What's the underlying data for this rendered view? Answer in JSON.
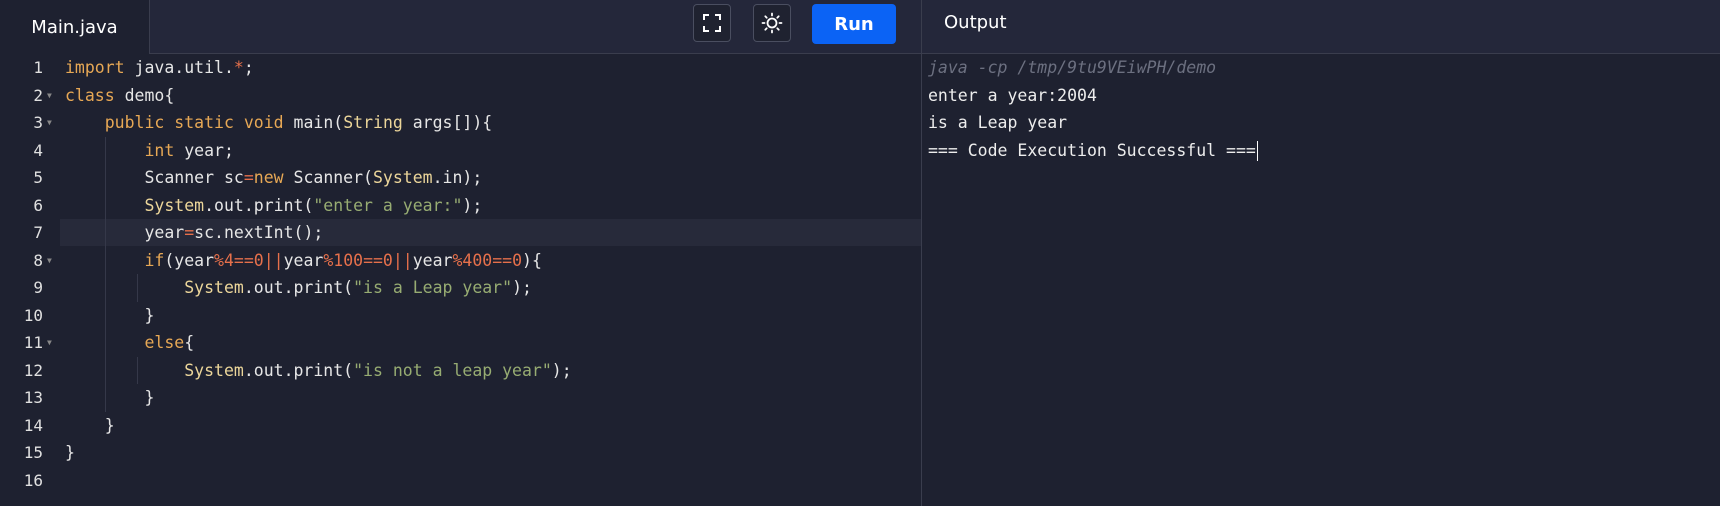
{
  "editor": {
    "filename": "Main.java",
    "line_numbers": [
      "1",
      "2",
      "3",
      "4",
      "5",
      "6",
      "7",
      "8",
      "9",
      "10",
      "11",
      "12",
      "13",
      "14",
      "15",
      "16"
    ]
  },
  "toolbar": {
    "fullscreen_icon": "fullscreen-icon",
    "theme_icon": "sun-icon",
    "run_label": "Run",
    "run_color": "#0b63f5"
  },
  "output": {
    "title": "Output",
    "command": "java -cp /tmp/9tu9VEiwPH/demo",
    "lines": [
      "enter a year:2004",
      "is a Leap year",
      "=== Code Execution Successful ==="
    ]
  },
  "code": {
    "l1": {
      "kw": "import",
      "rest": " java.util.",
      "op": "*",
      "end": ";"
    },
    "l2": {
      "kw": "class",
      "rest": " demo{"
    },
    "l3": {
      "kw1": "public",
      "kw2": "static",
      "kw3": "void",
      "name": " main(",
      "cls": "String",
      "rest": " args[]){"
    },
    "l4": {
      "kw": "int",
      "rest": " year;"
    },
    "l5": {
      "a": "Scanner sc",
      "op1": "=",
      "kw": "new",
      "b": " Scanner(",
      "cls": "System",
      "c": ".in);"
    },
    "l6": {
      "cls": "System",
      "a": ".out.print(",
      "str": "\"enter a year:\"",
      "b": ");"
    },
    "l7": {
      "a": "year",
      "op": "=",
      "b": "sc.nextInt();"
    },
    "l8": {
      "kw": "if",
      "a": "(year",
      "o1": "%4==0||",
      "b": "year",
      "o2": "%100==0||",
      "c": "year",
      "o3": "%400==0",
      "d": "){"
    },
    "l9": {
      "cls": "System",
      "a": ".out.print(",
      "str": "\"is a Leap year\"",
      "b": ");"
    },
    "l10": {
      "a": "}"
    },
    "l11": {
      "kw": "else",
      "a": "{"
    },
    "l12": {
      "cls": "System",
      "a": ".out.print(",
      "str": "\"is not a leap year\"",
      "b": ");"
    },
    "l13": {
      "a": "}"
    },
    "l14": {
      "a": "}"
    },
    "l15": {
      "a": "}"
    }
  }
}
